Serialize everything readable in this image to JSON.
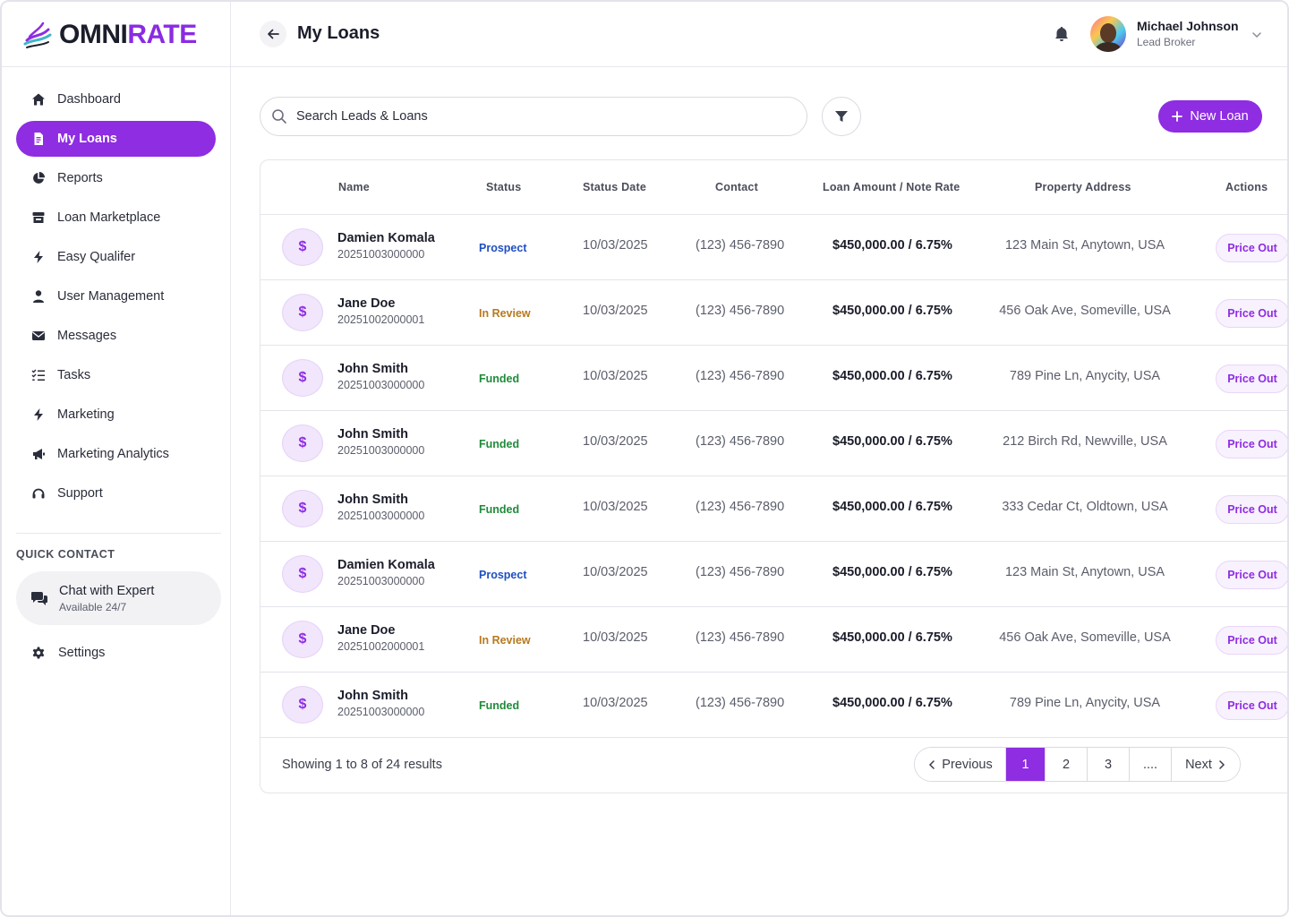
{
  "brand": {
    "part1": "OMNI",
    "part2": "RATE",
    "accent_color": "#8e2de2"
  },
  "sidebar": {
    "items": [
      {
        "label": "Dashboard",
        "icon": "home-icon",
        "active": false
      },
      {
        "label": "My Loans",
        "icon": "document-icon",
        "active": true
      },
      {
        "label": "Reports",
        "icon": "pie-chart-icon",
        "active": false
      },
      {
        "label": "Loan Marketplace",
        "icon": "store-icon",
        "active": false
      },
      {
        "label": "Easy Qualifer",
        "icon": "bolt-icon",
        "active": false
      },
      {
        "label": "User Management",
        "icon": "user-icon",
        "active": false
      },
      {
        "label": "Messages",
        "icon": "envelope-icon",
        "active": false
      },
      {
        "label": "Tasks",
        "icon": "checklist-icon",
        "active": false
      },
      {
        "label": "Marketing",
        "icon": "bolt-icon",
        "active": false
      },
      {
        "label": "Marketing Analytics",
        "icon": "megaphone-icon",
        "active": false
      },
      {
        "label": "Support",
        "icon": "headset-icon",
        "active": false
      }
    ],
    "quick_contact": {
      "title": "QUICK CONTACT",
      "chat_title": "Chat with Expert",
      "chat_subtitle": "Available 24/7"
    },
    "settings_label": "Settings"
  },
  "header": {
    "title": "My Loans",
    "user_name": "Michael Johnson",
    "user_role": "Lead Broker"
  },
  "search": {
    "placeholder": "Search Leads & Loans"
  },
  "new_loan_label": "New Loan",
  "table": {
    "columns": {
      "name": "Name",
      "status": "Status",
      "status_date": "Status Date",
      "contact": "Contact",
      "amount": "Loan Amount / Note Rate",
      "address": "Property Address",
      "actions": "Actions"
    },
    "rows": [
      {
        "name": "Damien Komala",
        "id": "20251003000000",
        "status": "Prospect",
        "date": "10/03/2025",
        "contact": "(123) 456-7890",
        "amount": "$450,000.00 / 6.75%",
        "address": "123 Main St, Anytown, USA",
        "action": "Price Out"
      },
      {
        "name": "Jane Doe",
        "id": "20251002000001",
        "status": "In Review",
        "date": "10/03/2025",
        "contact": "(123) 456-7890",
        "amount": "$450,000.00 / 6.75%",
        "address": "456 Oak Ave, Someville, USA",
        "action": "Price Out"
      },
      {
        "name": "John Smith",
        "id": "20251003000000",
        "status": "Funded",
        "date": "10/03/2025",
        "contact": "(123) 456-7890",
        "amount": "$450,000.00 / 6.75%",
        "address": "789 Pine Ln, Anycity, USA",
        "action": "Price Out"
      },
      {
        "name": "John Smith",
        "id": "20251003000000",
        "status": "Funded",
        "date": "10/03/2025",
        "contact": "(123) 456-7890",
        "amount": "$450,000.00 / 6.75%",
        "address": "212 Birch Rd, Newville, USA",
        "action": "Price Out"
      },
      {
        "name": "John Smith",
        "id": "20251003000000",
        "status": "Funded",
        "date": "10/03/2025",
        "contact": "(123) 456-7890",
        "amount": "$450,000.00 / 6.75%",
        "address": "333 Cedar Ct, Oldtown, USA",
        "action": "Price Out"
      },
      {
        "name": "Damien Komala",
        "id": "20251003000000",
        "status": "Prospect",
        "date": "10/03/2025",
        "contact": "(123) 456-7890",
        "amount": "$450,000.00 / 6.75%",
        "address": "123 Main St, Anytown, USA",
        "action": "Price Out"
      },
      {
        "name": "Jane Doe",
        "id": "20251002000001",
        "status": "In Review",
        "date": "10/03/2025",
        "contact": "(123) 456-7890",
        "amount": "$450,000.00 / 6.75%",
        "address": "456 Oak Ave, Someville, USA",
        "action": "Price Out"
      },
      {
        "name": "John Smith",
        "id": "20251003000000",
        "status": "Funded",
        "date": "10/03/2025",
        "contact": "(123) 456-7890",
        "amount": "$450,000.00 / 6.75%",
        "address": "789 Pine Ln, Anycity, USA",
        "action": "Price Out"
      }
    ],
    "status_colors": {
      "Prospect": "#1f4fc1",
      "In Review": "#b7791f",
      "Funded": "#1f8a3a"
    }
  },
  "pagination": {
    "showing_text": "Showing 1 to 8 of 24 results",
    "previous_label": "Previous",
    "next_label": "Next",
    "pages": [
      "1",
      "2",
      "3",
      "...."
    ],
    "current_page": "1"
  }
}
